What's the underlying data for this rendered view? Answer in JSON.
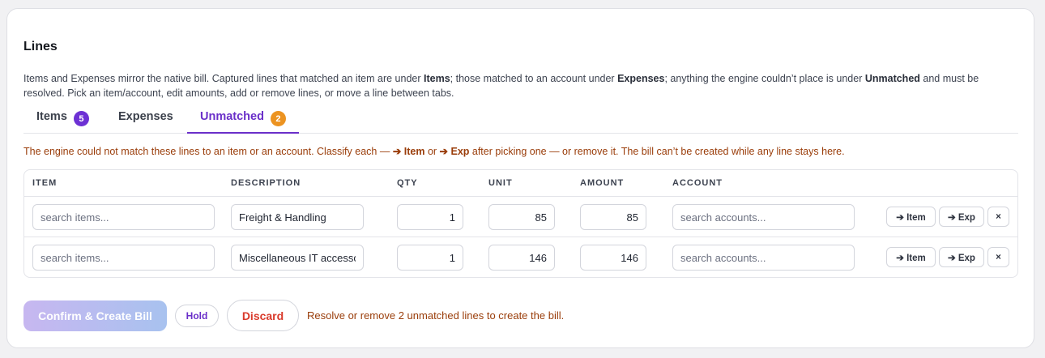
{
  "section": {
    "title": "Lines",
    "intro": {
      "t1": "Items and Expenses mirror the native bill. Captured lines that matched an item are under ",
      "b1": "Items",
      "t2": "; those matched to an account under ",
      "b2": "Expenses",
      "t3": "; anything the engine couldn’t place is under ",
      "b3": "Unmatched",
      "t4": " and must be resolved. Pick an item/account, edit amounts, add or remove lines, or move a line between tabs."
    }
  },
  "tabs": [
    {
      "label": "Items",
      "count": "5",
      "badge_color": "#6d31d4"
    },
    {
      "label": "Expenses",
      "count": ""
    },
    {
      "label": "Unmatched",
      "count": "2",
      "badge_color": "#ec9321",
      "active": true
    }
  ],
  "warning": {
    "t1": "The engine could not match these lines to an item or an account. Classify each — ",
    "b1": "➔ Item",
    "t2": " or ",
    "b2": "➔ Exp",
    "t3": " after picking one — or remove it. The bill can’t be created while any line stays here."
  },
  "table": {
    "headers": [
      "ITEM",
      "DESCRIPTION",
      "QTY",
      "UNIT",
      "AMOUNT",
      "ACCOUNT"
    ],
    "item_placeholder": "search items...",
    "account_placeholder": "search accounts...",
    "rows": [
      {
        "description": "Freight & Handling",
        "qty": "1",
        "unit": "85",
        "amount": "85"
      },
      {
        "description": "Miscellaneous IT accessories",
        "qty": "1",
        "unit": "146",
        "amount": "146"
      }
    ],
    "actions": {
      "to_item": "➔ Item",
      "to_exp": "➔ Exp",
      "remove": "×"
    }
  },
  "footer": {
    "confirm_label": "Confirm & Create Bill",
    "hold_label": "Hold",
    "discard_label": "Discard",
    "message": "Resolve or remove 2 unmatched lines to create the bill."
  },
  "colors": {
    "accent": "#6a2fc9",
    "warning_text": "#9a3d0a",
    "danger": "#d93a2b"
  }
}
